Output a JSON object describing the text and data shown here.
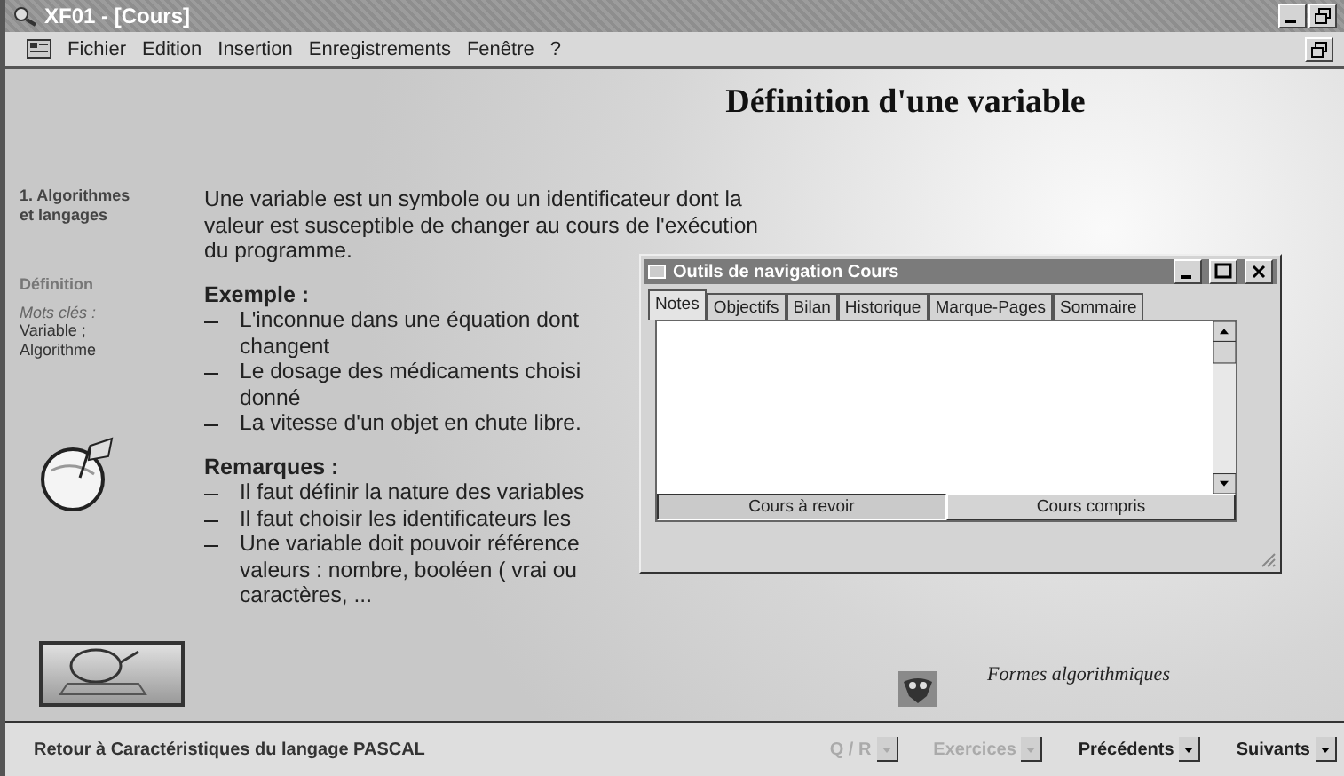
{
  "window": {
    "title": "XF01 - [Cours]"
  },
  "menu": [
    {
      "label": "Fichier"
    },
    {
      "label": "Edition"
    },
    {
      "label": "Insertion"
    },
    {
      "label": "Enregistrements"
    },
    {
      "label": "Fenêtre"
    },
    {
      "label": "?"
    }
  ],
  "heading": "Définition d'une variable",
  "sidebar": {
    "section": "1. Algorithmes et langages",
    "current": "Définition",
    "keywords_label": "Mots clés :",
    "keywords": [
      "Variable ;",
      "Algorithme"
    ]
  },
  "body": {
    "intro": [
      "Une variable est un symbole ou un identificateur dont la",
      "valeur est susceptible de changer au cours de l'exécution",
      "du programme."
    ],
    "sections": [
      {
        "title": "Exemple :",
        "items": [
          [
            "L'inconnue dans une équation dont",
            "changent"
          ],
          [
            "Le dosage des médicaments choisi",
            "donné"
          ],
          [
            "La vitesse d'un objet en chute libre."
          ]
        ]
      },
      {
        "title": "Remarques :",
        "items": [
          [
            "Il faut définir la nature des variables"
          ],
          [
            "Il faut choisir les identificateurs les"
          ],
          [
            "Une variable doit pouvoir référence",
            "valeurs : nombre, booléen ( vrai ou",
            "caractères, ..."
          ]
        ]
      }
    ]
  },
  "nav_window": {
    "title": "Outils de navigation Cours",
    "tabs": [
      {
        "label": "Notes",
        "selected": true
      },
      {
        "label": "Objectifs",
        "selected": false
      },
      {
        "label": "Bilan",
        "selected": false
      },
      {
        "label": "Historique",
        "selected": false
      },
      {
        "label": "Marque-Pages",
        "selected": false
      },
      {
        "label": "Sommaire",
        "selected": false
      }
    ],
    "buttons": [
      {
        "label": "Cours à revoir",
        "pressed": true
      },
      {
        "label": "Cours compris",
        "pressed": false
      }
    ]
  },
  "related": "Formes algorithmiques",
  "status_bar": {
    "back_link": "Retour à Caractéristiques du langage PASCAL",
    "menus": [
      {
        "label": "Q / R",
        "disabled": true
      },
      {
        "label": "Exercices",
        "disabled": true
      },
      {
        "label": "Précédents",
        "disabled": false
      },
      {
        "label": "Suivants",
        "disabled": false
      }
    ]
  }
}
